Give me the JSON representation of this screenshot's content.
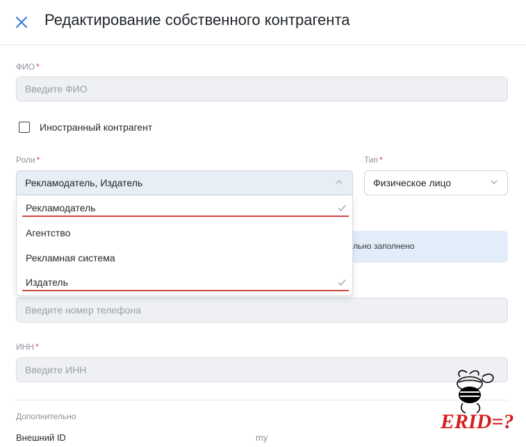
{
  "header": {
    "title": "Редактирование собственного контрагента",
    "close_icon": "close-icon"
  },
  "form": {
    "fio": {
      "label": "ФИО",
      "required_mark": "*",
      "placeholder": "Введите ФИО"
    },
    "foreign": {
      "label": "Иностранный контрагент",
      "checked": false
    },
    "roles": {
      "label": "Роли",
      "required_mark": "*",
      "value": "Рекламодатель, Издатель",
      "expanded": true,
      "options": [
        {
          "label": "Рекламодатель",
          "selected": true
        },
        {
          "label": "Агентство",
          "selected": false
        },
        {
          "label": "Рекламная система",
          "selected": false
        },
        {
          "label": "Издатель",
          "selected": true
        }
      ]
    },
    "type": {
      "label": "Тип",
      "required_mark": "*",
      "value": "Физическое лицо"
    },
    "info_partial": "льно заполнено",
    "phone": {
      "placeholder": "Введите номер телефона"
    },
    "inn": {
      "label": "ИНН",
      "required_mark": "*",
      "placeholder": "Введите ИНН"
    },
    "additional": {
      "section_label": "Дополнительно",
      "external_id_label": "Внешний ID",
      "external_id_value": "my"
    }
  },
  "watermark": {
    "text": "ERID=?"
  },
  "colors": {
    "accent": "#2e7bd6",
    "required": "#e0443e",
    "highlight_underline": "#d0463f",
    "watermark": "#d42020"
  }
}
